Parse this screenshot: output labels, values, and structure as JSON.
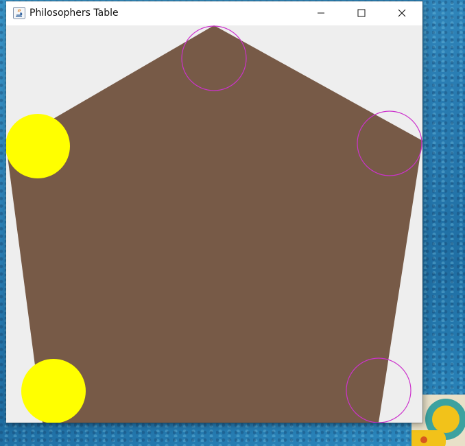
{
  "window": {
    "title": "Philosophers Table",
    "controls": {
      "minimize_icon": "minimize-icon",
      "maximize_icon": "maximize-icon",
      "close_icon": "close-icon"
    }
  },
  "scene": {
    "table_shape": "pentagon",
    "table_color": "#775a47",
    "background_color": "#eeeeee",
    "eating_color": "#ffff00",
    "thinking_outline_color": "#cc33cc",
    "philosophers": [
      {
        "position": "top",
        "state": "thinking"
      },
      {
        "position": "upper-right",
        "state": "thinking"
      },
      {
        "position": "lower-right",
        "state": "thinking"
      },
      {
        "position": "lower-left",
        "state": "eating"
      },
      {
        "position": "upper-left",
        "state": "eating"
      }
    ]
  }
}
